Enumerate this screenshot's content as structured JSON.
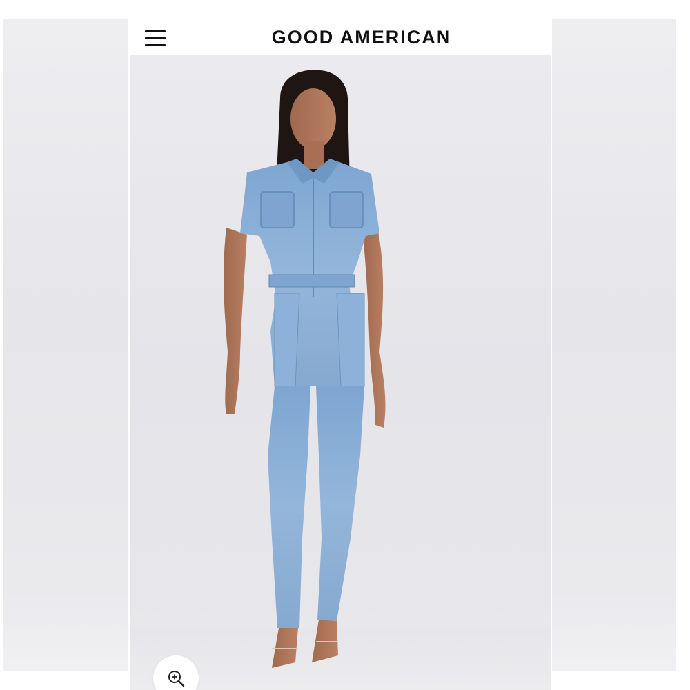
{
  "header": {
    "brand": "GOOD AMERICAN",
    "menu_icon": "hamburger-menu-icon"
  },
  "product_image": {
    "subject": "model",
    "zoom_icon": "zoom-in-icon"
  },
  "colors": {
    "header_bg": "#ffffff",
    "brand_text": "#111111",
    "denim": "#8fb3d9",
    "backdrop": "#e8e8ec"
  }
}
